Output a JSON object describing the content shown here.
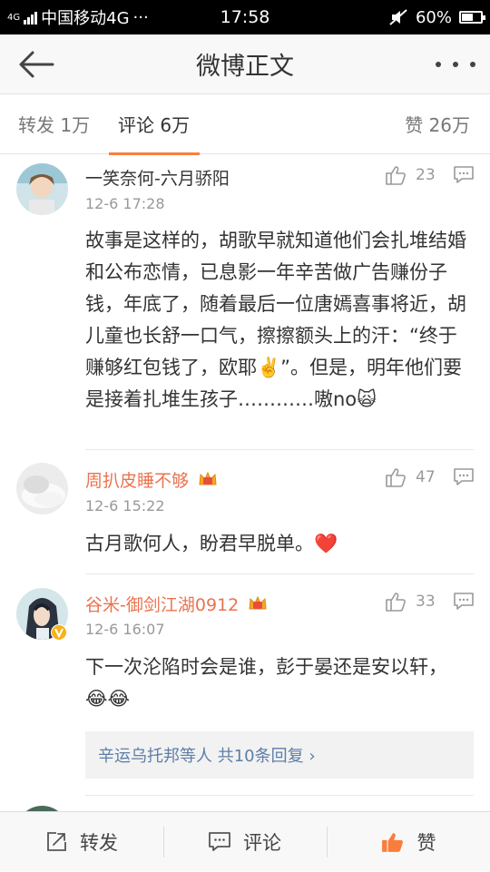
{
  "status_bar": {
    "network_tag": "4G",
    "carrier": "中国移动4G",
    "more_dots": "···",
    "time": "17:58",
    "battery": "60%"
  },
  "nav": {
    "title": "微博正文"
  },
  "tabs": {
    "repost": "转发 1万",
    "comments": "评论 6万",
    "likes": "赞 26万"
  },
  "comments": [
    {
      "user": "一笑奈何-六月骄阳",
      "time": "12-6 17:28",
      "likes": "23",
      "text": "故事是这样的，胡歌早就知道他们会扎堆结婚和公布恋情，已息影一年辛苦做广告赚份子钱，年底了，随着最后一位唐嫣喜事将近，胡儿童也长舒一口气，擦擦额头上的汗：“终于赚够红包钱了，欧耶✌️”。但是，明年他们要是接着扎堆生孩子…………嗷no🙀"
    },
    {
      "user": "周扒皮睡不够",
      "time": "12-6 15:22",
      "likes": "47",
      "text": "古月歌何人，盼君早脱单。❤️"
    },
    {
      "user": "谷米-御剑江湖0912",
      "time": "12-6 16:07",
      "likes": "33",
      "text": "下一次沦陷时会是谁，彭于晏还是安以轩，😂😂",
      "replies_summary": "辛运乌托邦等人 共10条回复 ›"
    }
  ],
  "bottom_bar": {
    "repost": "转发",
    "comment": "评论",
    "like": "赞"
  },
  "colors": {
    "accent_orange": "#fa7d3c",
    "username_orange": "#eb7350",
    "link_blue": "#5d7ea7",
    "bar_background": "#f8f8f8"
  }
}
